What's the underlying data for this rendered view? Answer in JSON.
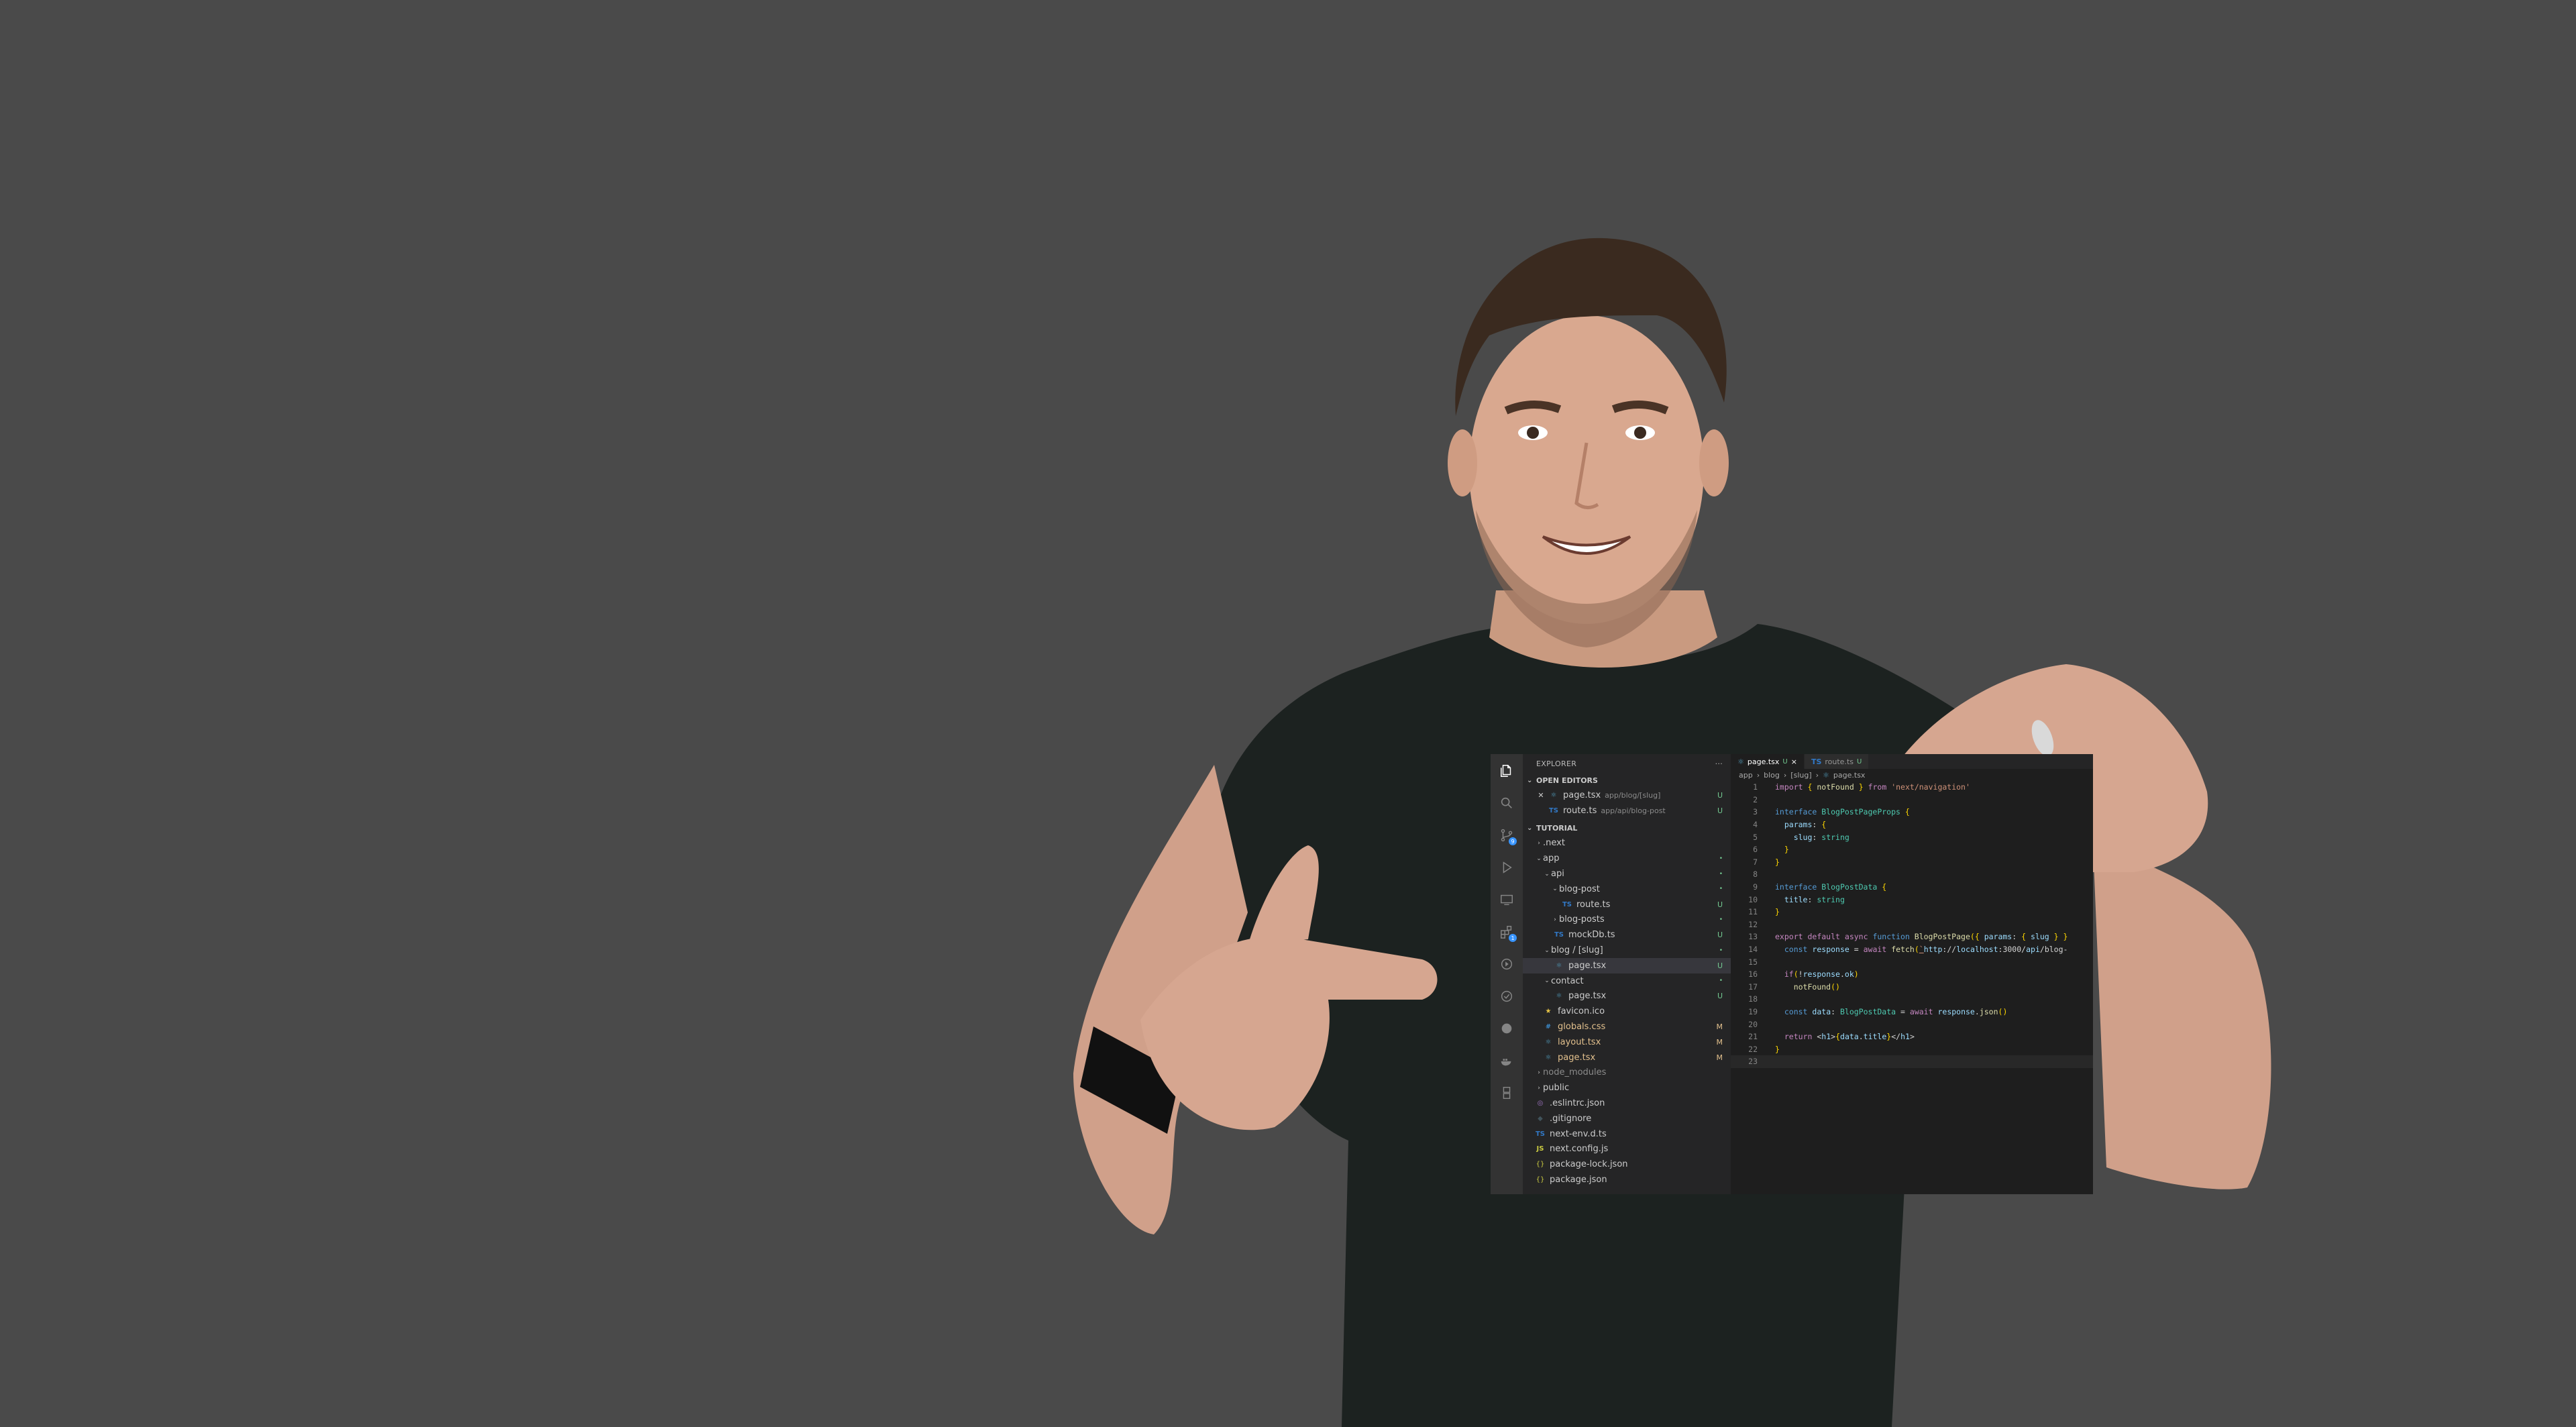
{
  "colors": {
    "background": "#4a4a4a",
    "editor_bg": "#1e1e1e",
    "sidebar_bg": "#252526",
    "activity_bg": "#333333",
    "untracked": "#73c991",
    "modified": "#e2c08d"
  },
  "activity_bar": {
    "icons": [
      "files-icon",
      "search-icon",
      "source-control-icon",
      "run-debug-icon",
      "remote-explorer-icon",
      "extensions-icon",
      "timeline-icon",
      "testing-icon",
      "github-icon",
      "docker-icon",
      "tool-icon"
    ],
    "source_control_badge": "9",
    "extensions_badge": "1"
  },
  "explorer": {
    "title": "EXPLORER",
    "more": "···",
    "open_editors": {
      "label": "OPEN EDITORS",
      "items": [
        {
          "name": "page.tsx",
          "path": "app/blog/[slug]",
          "status": "U"
        },
        {
          "name": "route.ts",
          "path": "app/api/blog-post",
          "status": "U"
        }
      ]
    },
    "workspace": {
      "label": "TUTORIAL",
      "items": [
        {
          "name": ".next",
          "status": ""
        },
        {
          "name": "app",
          "status": "•"
        },
        {
          "name": "api",
          "status": "•"
        },
        {
          "name": "blog-post",
          "status": "•"
        },
        {
          "name": "route.ts",
          "status": "U"
        },
        {
          "name": "blog-posts",
          "status": "•"
        },
        {
          "name": "mockDb.ts",
          "status": "U"
        },
        {
          "name": "blog / [slug]",
          "status": "•"
        },
        {
          "name": "page.tsx",
          "status": "U"
        },
        {
          "name": "contact",
          "status": "•"
        },
        {
          "name": "page.tsx",
          "status": "U"
        },
        {
          "name": "favicon.ico",
          "status": ""
        },
        {
          "name": "globals.css",
          "status": "M"
        },
        {
          "name": "layout.tsx",
          "status": "M"
        },
        {
          "name": "page.tsx",
          "status": "M"
        },
        {
          "name": "node_modules",
          "status": ""
        },
        {
          "name": "public",
          "status": ""
        },
        {
          "name": ".eslintrc.json",
          "status": ""
        },
        {
          "name": ".gitignore",
          "status": ""
        },
        {
          "name": "next-env.d.ts",
          "status": ""
        },
        {
          "name": "next.config.js",
          "status": ""
        },
        {
          "name": "package-lock.json",
          "status": ""
        },
        {
          "name": "package.json",
          "status": ""
        }
      ]
    }
  },
  "tabs": [
    {
      "label": "page.tsx",
      "status": "U",
      "close": "×"
    },
    {
      "label": "route.ts",
      "status": "U"
    }
  ],
  "breadcrumb": [
    "app",
    "blog",
    "[slug]",
    "page.tsx"
  ],
  "code": {
    "line_numbers": [
      "1",
      "2",
      "3",
      "4",
      "5",
      "6",
      "7",
      "8",
      "9",
      "10",
      "11",
      "12",
      "13",
      "14",
      "15",
      "16",
      "17",
      "18",
      "19",
      "20",
      "21",
      "22",
      "23"
    ],
    "lines": [
      "import { notFound } from 'next/navigation'",
      "",
      "interface BlogPostPageProps {",
      "  params: {",
      "    slug: string",
      "  }",
      "}",
      "",
      "interface BlogPostData {",
      "  title: string",
      "}",
      "",
      "export default async function BlogPostPage({ params: { slug } }",
      "  const response = await fetch(`http://localhost:3000/api/blog-",
      "",
      "  if(!response.ok)",
      "    notFound()",
      "",
      "  const data: BlogPostData = await response.json()",
      "",
      "  return <h1>{data.title}</h1>",
      "}",
      ""
    ]
  }
}
